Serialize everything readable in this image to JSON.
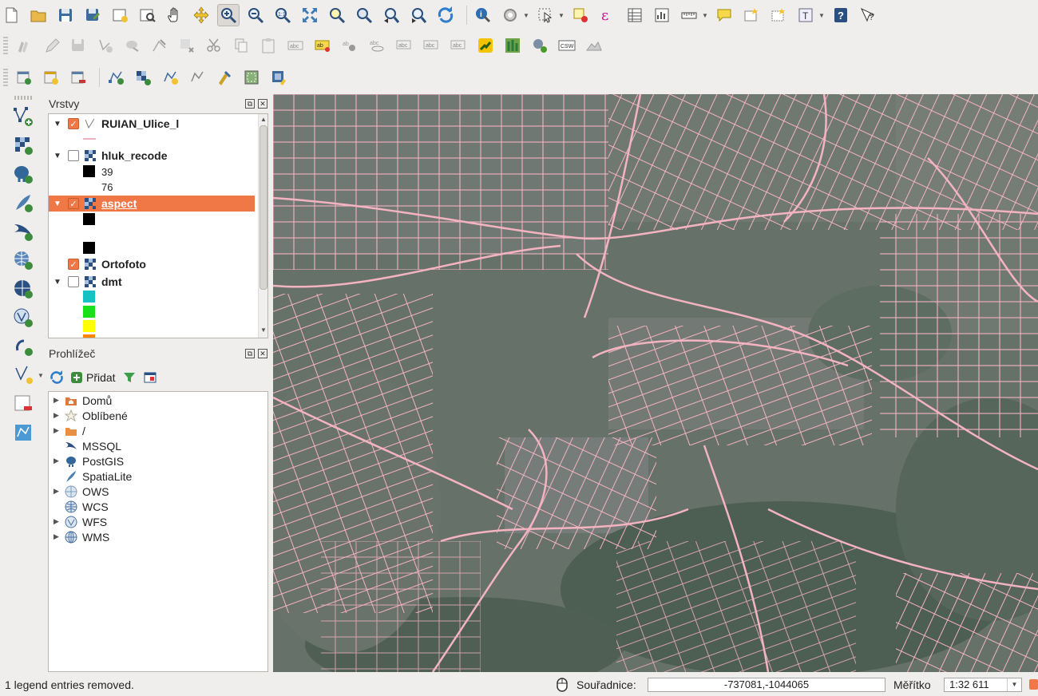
{
  "layers_panel": {
    "title": "Vrstvy",
    "layers": [
      {
        "name": "RUIAN_Ulice_l",
        "checked": true,
        "icon": "vector-line-icon"
      },
      {
        "name": "hluk_recode",
        "checked": false,
        "icon": "raster-icon",
        "legend": [
          {
            "label": "39",
            "color": "#000000"
          },
          {
            "label": "76",
            "color": ""
          }
        ]
      },
      {
        "name": "aspect",
        "checked": true,
        "selected": true,
        "icon": "raster-icon",
        "legend": [
          {
            "label": "",
            "color": "#000000"
          },
          {
            "label": "",
            "color": "#000000"
          }
        ]
      },
      {
        "name": "Ortofoto",
        "checked": true,
        "icon": "raster-icon"
      },
      {
        "name": "dmt",
        "checked": false,
        "icon": "raster-icon",
        "legend": [
          {
            "color": "#17c1c1"
          },
          {
            "color": "#19e019"
          },
          {
            "color": "#ffff00"
          },
          {
            "color": "#ff8800"
          }
        ]
      }
    ]
  },
  "browser_panel": {
    "title": "Prohlížeč",
    "add_label": "Přidat",
    "items": [
      {
        "label": "Domů",
        "icon": "home-folder-icon",
        "expandable": true
      },
      {
        "label": "Oblíbené",
        "icon": "star-icon",
        "expandable": true
      },
      {
        "label": "/",
        "icon": "folder-icon",
        "expandable": true
      },
      {
        "label": "MSSQL",
        "icon": "mssql-icon",
        "expandable": false
      },
      {
        "label": "PostGIS",
        "icon": "postgis-elephant-icon",
        "expandable": true
      },
      {
        "label": "SpatiaLite",
        "icon": "spatialite-feather-icon",
        "expandable": false
      },
      {
        "label": "OWS",
        "icon": "ows-globe-icon",
        "expandable": true
      },
      {
        "label": "WCS",
        "icon": "wcs-globe-icon",
        "expandable": false
      },
      {
        "label": "WFS",
        "icon": "wfs-globe-icon",
        "expandable": true
      },
      {
        "label": "WMS",
        "icon": "wms-globe-icon",
        "expandable": true
      }
    ]
  },
  "statusbar": {
    "message": "1 legend entries removed.",
    "coord_label": "Souřadnice:",
    "coord_value": "-737081,-1044065",
    "scale_label": "Měřítko",
    "scale_value": "1:32 611"
  },
  "colors": {
    "accent": "#f07746",
    "road": "#f4b3c0",
    "ortho": "#5d6a62"
  }
}
